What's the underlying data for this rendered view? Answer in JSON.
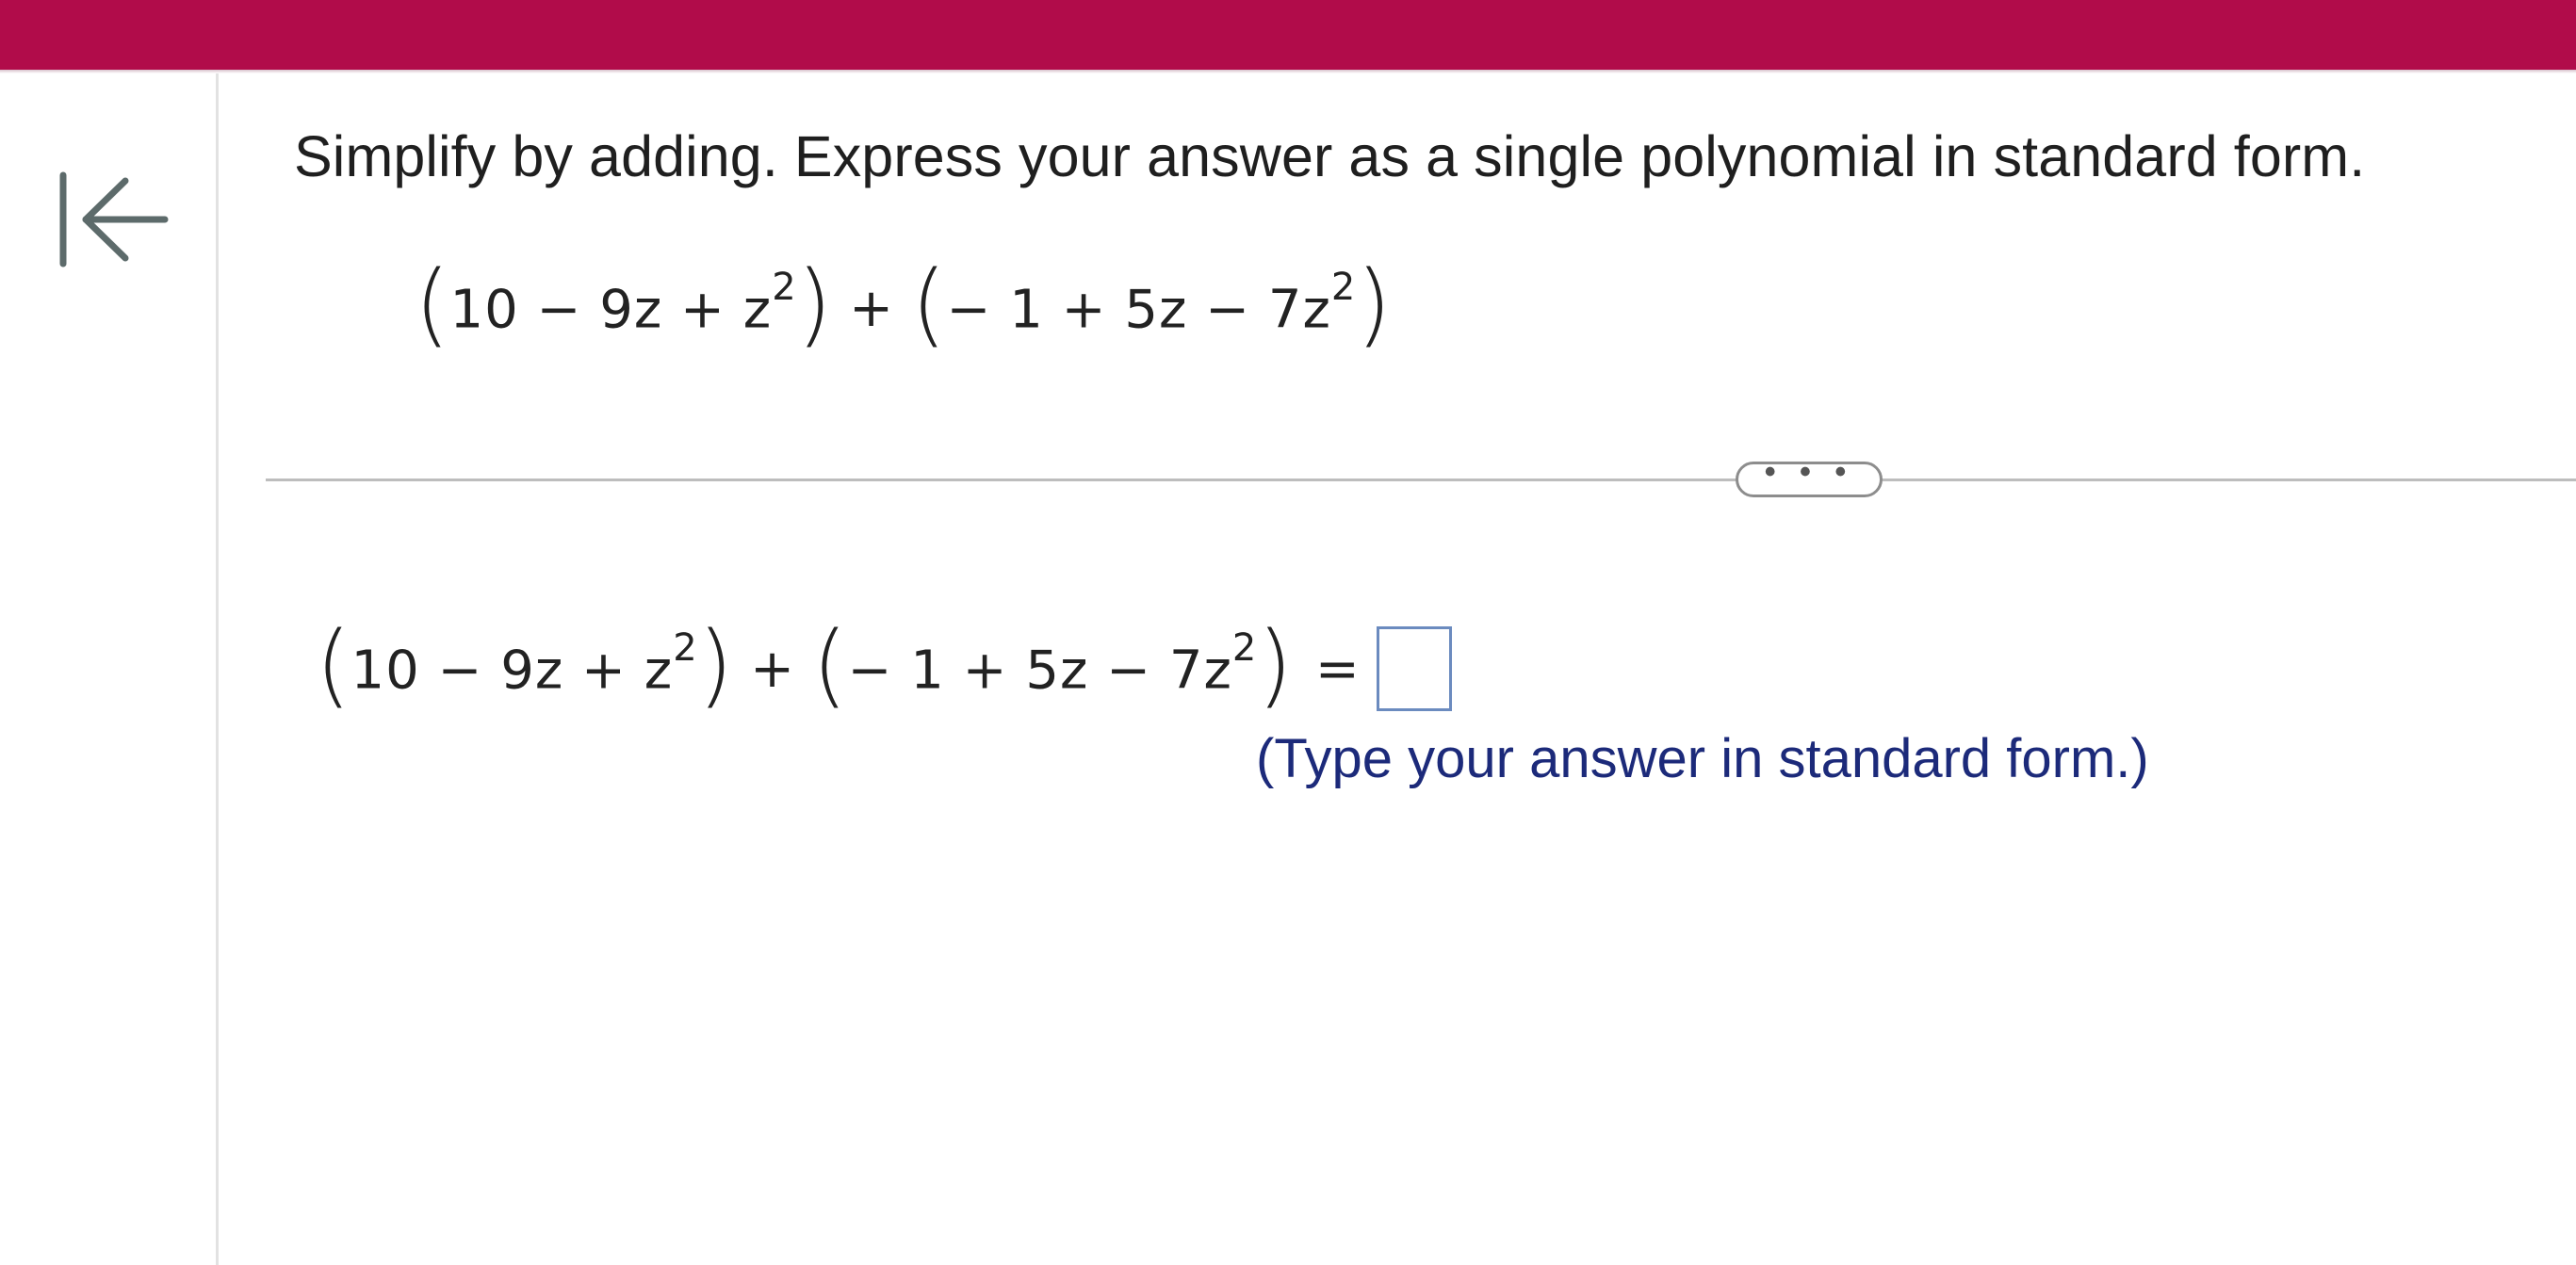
{
  "header": {
    "bar_color": "#b10c4a"
  },
  "nav": {
    "collapse_icon": "collapse-left-icon"
  },
  "question": {
    "instruction": "Simplify by adding. Express your answer as a single polynomial in standard form.",
    "expression": {
      "first": {
        "t1": "10 − 9z + z",
        "exp": "2"
      },
      "plus": "+",
      "second": {
        "t1": "− 1 + 5z − 7z",
        "exp": "2"
      }
    }
  },
  "divider": {
    "more_label": "• • •"
  },
  "answer": {
    "expression": {
      "first": {
        "t1": "10 − 9z + z",
        "exp": "2"
      },
      "plus": "+",
      "second": {
        "t1": "− 1 + 5z − 7z",
        "exp": "2"
      }
    },
    "equals": "=",
    "input_value": "",
    "hint": "(Type your answer in standard form.)"
  }
}
